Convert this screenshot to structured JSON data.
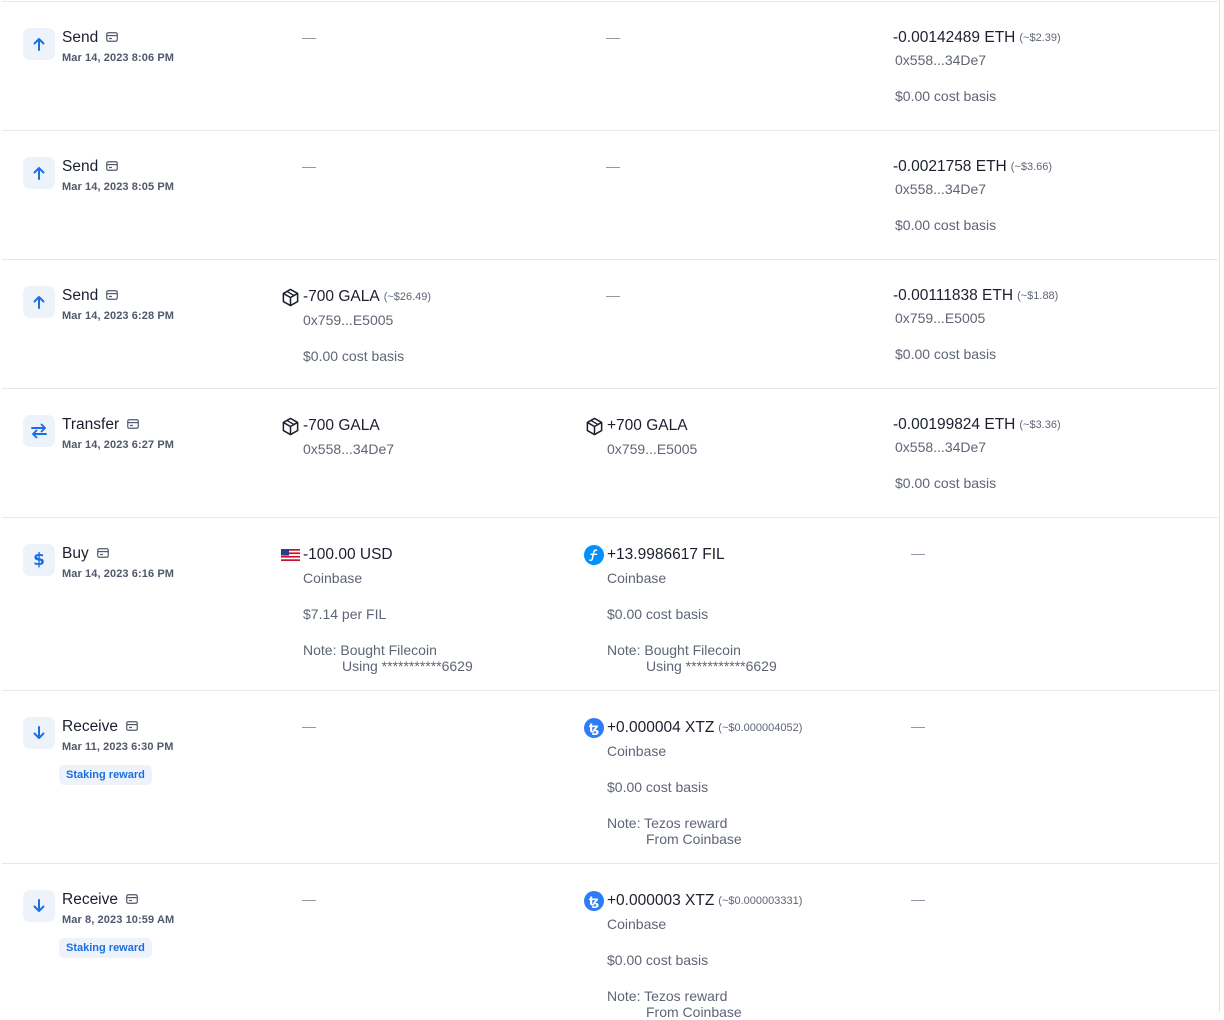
{
  "rows": [
    {
      "type": "Send",
      "date": "Mar 14, 2023 8:06 PM",
      "c1_dash": "—",
      "c2_dash": "—",
      "fee": {
        "amount": "-0.00142489 ETH",
        "usd": "(~$2.39)",
        "address": "0x558...34De7",
        "basis": "$0.00 cost basis"
      }
    },
    {
      "type": "Send",
      "date": "Mar 14, 2023 8:05 PM",
      "c1_dash": "—",
      "c2_dash": "—",
      "fee": {
        "amount": "-0.0021758 ETH",
        "usd": "(~$3.66)",
        "address": "0x558...34De7",
        "basis": "$0.00 cost basis"
      }
    },
    {
      "type": "Send",
      "date": "Mar 14, 2023 6:28 PM",
      "sent": {
        "icon": "gala-icon",
        "amount": "-700 GALA",
        "usd": "(~$26.49)",
        "address": "0x759...E5005",
        "basis": "$0.00 cost basis"
      },
      "c2_dash": "—",
      "fee": {
        "amount": "-0.00111838 ETH",
        "usd": "(~$1.88)",
        "address": "0x759...E5005",
        "basis": "$0.00 cost basis"
      }
    },
    {
      "type": "Transfer",
      "date": "Mar 14, 2023 6:27 PM",
      "sent": {
        "icon": "gala-icon",
        "amount": "-700 GALA",
        "address": "0x558...34De7"
      },
      "received": {
        "icon": "gala-icon",
        "amount": "+700 GALA",
        "address": "0x759...E5005"
      },
      "fee": {
        "amount": "-0.00199824 ETH",
        "usd": "(~$3.36)",
        "address": "0x558...34De7",
        "basis": "$0.00 cost basis"
      }
    },
    {
      "type": "Buy",
      "date": "Mar 14, 2023 6:16 PM",
      "sent": {
        "icon": "us-flag-icon",
        "amount": "-100.00 USD",
        "source": "Coinbase",
        "rate": "$7.14 per FIL",
        "note_1": "Note: Bought Filecoin",
        "note_2": "Using ***********6629"
      },
      "received": {
        "icon": "filecoin-icon",
        "amount": "+13.9986617 FIL",
        "source": "Coinbase",
        "basis": "$0.00 cost basis",
        "note_1": "Note: Bought Filecoin",
        "note_2": "Using ***********6629"
      },
      "c3_dash": "—"
    },
    {
      "type": "Receive",
      "date": "Mar 11, 2023 6:30 PM",
      "tag": "Staking reward",
      "c1_dash": "—",
      "received": {
        "icon": "tezos-icon",
        "amount": "+0.000004 XTZ",
        "usd": "(~$0.000004052)",
        "source": "Coinbase",
        "basis": "$0.00 cost basis",
        "note_1": "Note: Tezos reward",
        "note_2": "From Coinbase"
      },
      "c3_dash": "—"
    },
    {
      "type": "Receive",
      "date": "Mar 8, 2023 10:59 AM",
      "tag": "Staking reward",
      "c1_dash": "—",
      "received": {
        "icon": "tezos-icon",
        "amount": "+0.000003 XTZ",
        "usd": "(~$0.000003331)",
        "source": "Coinbase",
        "basis": "$0.00 cost basis",
        "note_1": "Note: Tezos reward",
        "note_2": "From Coinbase"
      },
      "c3_dash": "—"
    }
  ],
  "colors": {
    "accent": "#1b6fe0",
    "icon_bg": "#eef3fb",
    "muted": "#5e6575",
    "divider": "#e6e8ec"
  }
}
